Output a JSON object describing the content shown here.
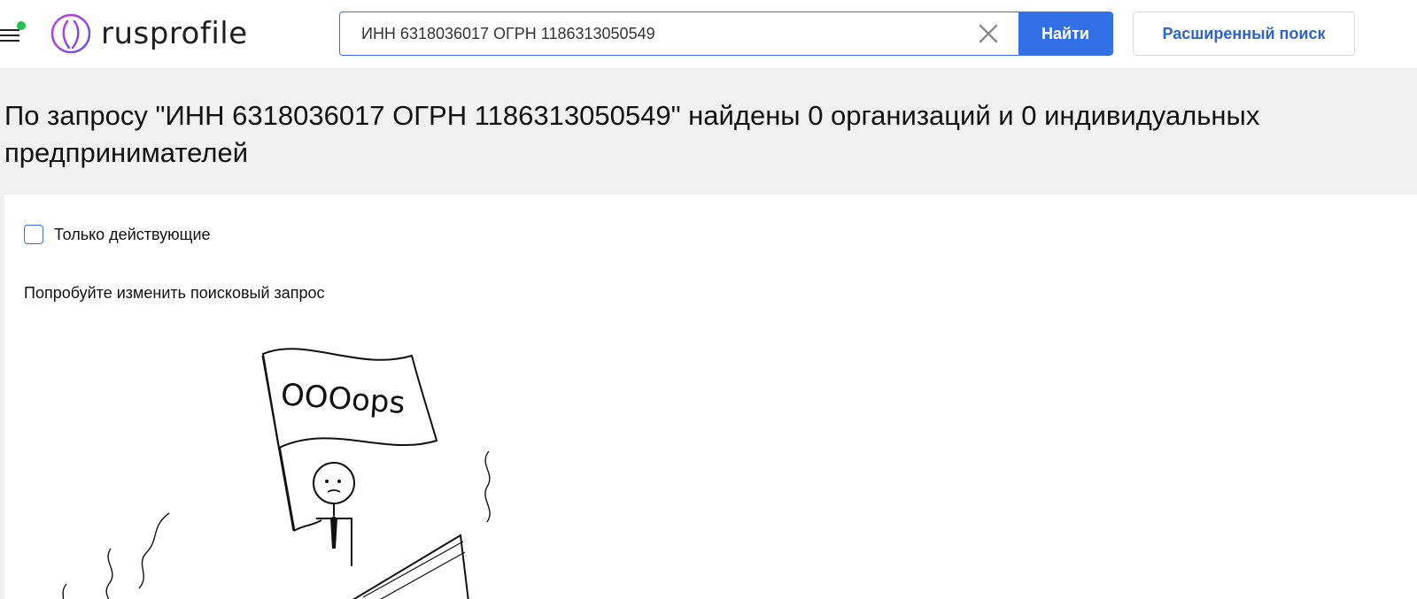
{
  "header": {
    "logo_text": "rusprofile",
    "search": {
      "value": "ИНН 6318036017 ОГРН 1186313050549",
      "button_label": "Найти"
    },
    "advanced_search_label": "Расширенный поиск",
    "accent_color": "#3270e8",
    "notification_dot_color": "#1fc24b"
  },
  "results": {
    "title": "По запросу \"ИНН 6318036017 ОГРН 1186313050549\" найдены 0 организаций и 0 индивидуальных предпринимателей",
    "filter_active_only_label": "Только действующие",
    "hint": "Попробуйте изменить поисковый запрос",
    "illustration_flag_text": "OOOops"
  },
  "icons": {
    "menu": "hamburger-menu-icon",
    "logo": "rusprofile-logo-icon",
    "clear": "close-icon"
  }
}
